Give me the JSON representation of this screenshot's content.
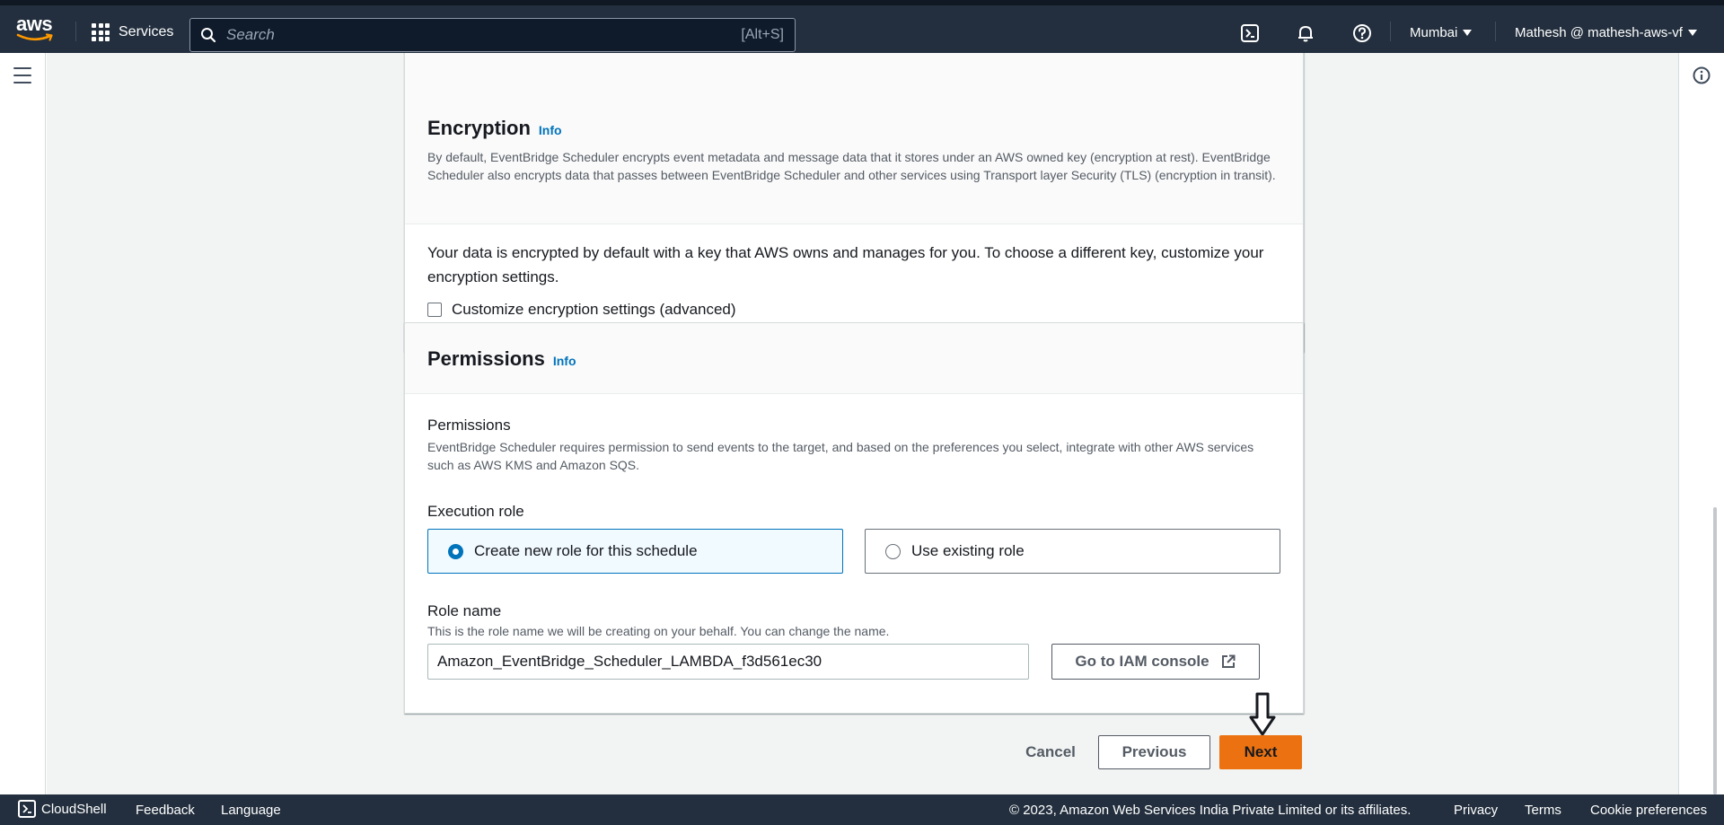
{
  "nav": {
    "logo": "aws",
    "services_label": "Services",
    "search_placeholder": "Search",
    "search_shortcut": "[Alt+S]",
    "region": "Mumbai",
    "account": "Mathesh @ mathesh-aws-vf",
    "icons": [
      "cloudshell-icon",
      "bell-icon",
      "help-icon"
    ]
  },
  "encryption": {
    "title": "Encryption",
    "info": "Info",
    "description": "By default, EventBridge Scheduler encrypts event metadata and message data that it stores under an AWS owned key (encryption at rest). EventBridge Scheduler also encrypts data that passes between EventBridge Scheduler and other services using Transport layer Security (TLS) (encryption in transit).",
    "body": "Your data is encrypted by default with a key that AWS owns and manages for you. To choose a different key, customize your encryption settings.",
    "checkbox_label": "Customize encryption settings (advanced)"
  },
  "permissions": {
    "title": "Permissions",
    "info": "Info",
    "section_label": "Permissions",
    "section_description": "EventBridge Scheduler requires permission to send events to the target, and based on the preferences you select, integrate with other AWS services such as AWS KMS and Amazon SQS.",
    "execution_role_label": "Execution role",
    "option_new": "Create new role for this schedule",
    "option_existing": "Use existing role",
    "role_name_label": "Role name",
    "role_name_description": "This is the role name we will be creating on your behalf. You can change the name.",
    "role_name_value": "Amazon_EventBridge_Scheduler_LAMBDA_f3d561ec30",
    "iam_button": "Go to IAM console"
  },
  "actions": {
    "cancel": "Cancel",
    "previous": "Previous",
    "next": "Next"
  },
  "footer": {
    "cloudshell": "CloudShell",
    "feedback": "Feedback",
    "language": "Language",
    "copyright": "© 2023, Amazon Web Services India Private Limited or its affiliates.",
    "privacy": "Privacy",
    "terms": "Terms",
    "cookie": "Cookie preferences"
  },
  "colors": {
    "nav_bg": "#232f3e",
    "accent_orange": "#ec7211",
    "link_blue": "#0073bb",
    "content_bg": "#f2f3f3"
  }
}
